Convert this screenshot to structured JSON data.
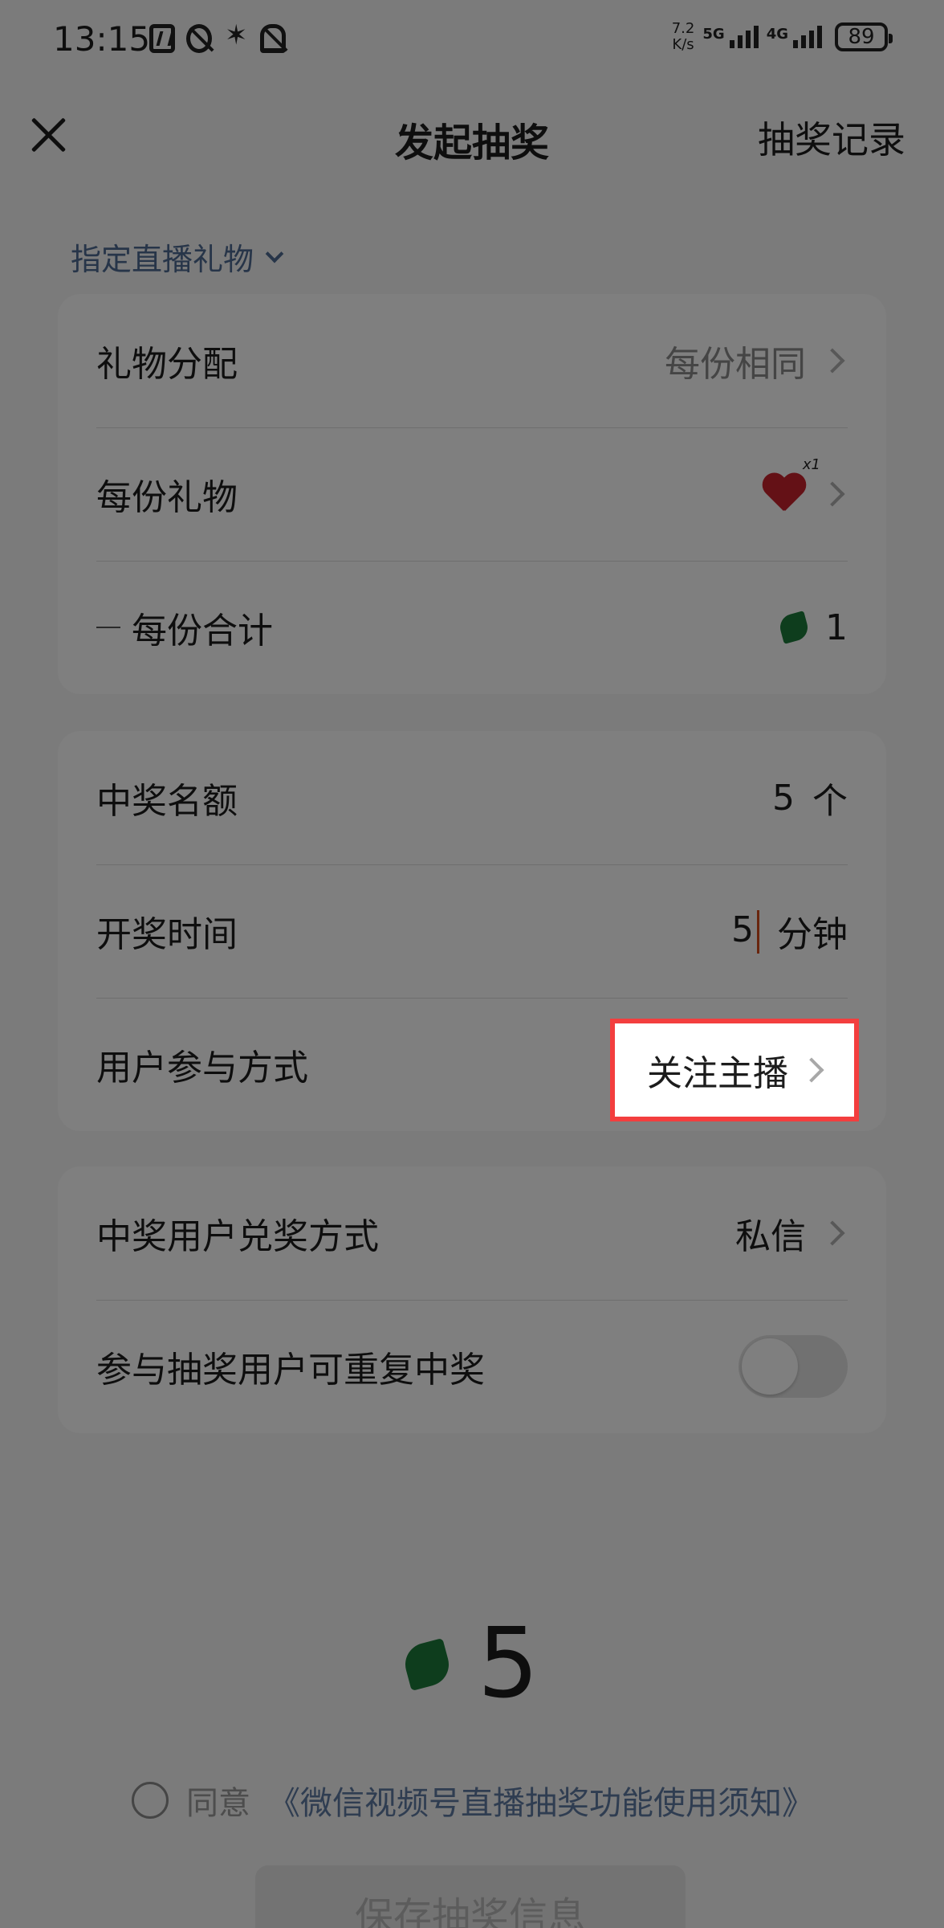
{
  "status_bar": {
    "time": "13:15",
    "speed_value": "7.2",
    "speed_unit": "K/s",
    "net1": "5G",
    "net2": "4G",
    "battery": "89"
  },
  "nav": {
    "title": "发起抽奖",
    "right_link": "抽奖记录"
  },
  "gift_type": "指定直播礼物",
  "gift_card": {
    "allocation_label": "礼物分配",
    "allocation_value": "每份相同",
    "gift_label": "每份礼物",
    "gift_qty": "x1",
    "subtotal_label": "每份合计",
    "subtotal_value": "1"
  },
  "rules_card": {
    "winners_label": "中奖名额",
    "winners_value": "5",
    "winners_unit": "个",
    "time_label": "开奖时间",
    "time_value": "5",
    "time_unit": "分钟",
    "participation_label": "用户参与方式",
    "participation_value": "关注主播"
  },
  "redeem_card": {
    "redeem_label": "中奖用户兑奖方式",
    "redeem_value": "私信",
    "repeat_label": "参与抽奖用户可重复中奖",
    "repeat_enabled": false
  },
  "total": "5",
  "agreement": {
    "prefix": "同意",
    "link": "《微信视频号直播抽奖功能使用须知》"
  },
  "save_button": "保存抽奖信息",
  "colors": {
    "highlight_border": "#f33e3e",
    "link": "#5f7aa3",
    "seed": "#1c7a3a"
  }
}
